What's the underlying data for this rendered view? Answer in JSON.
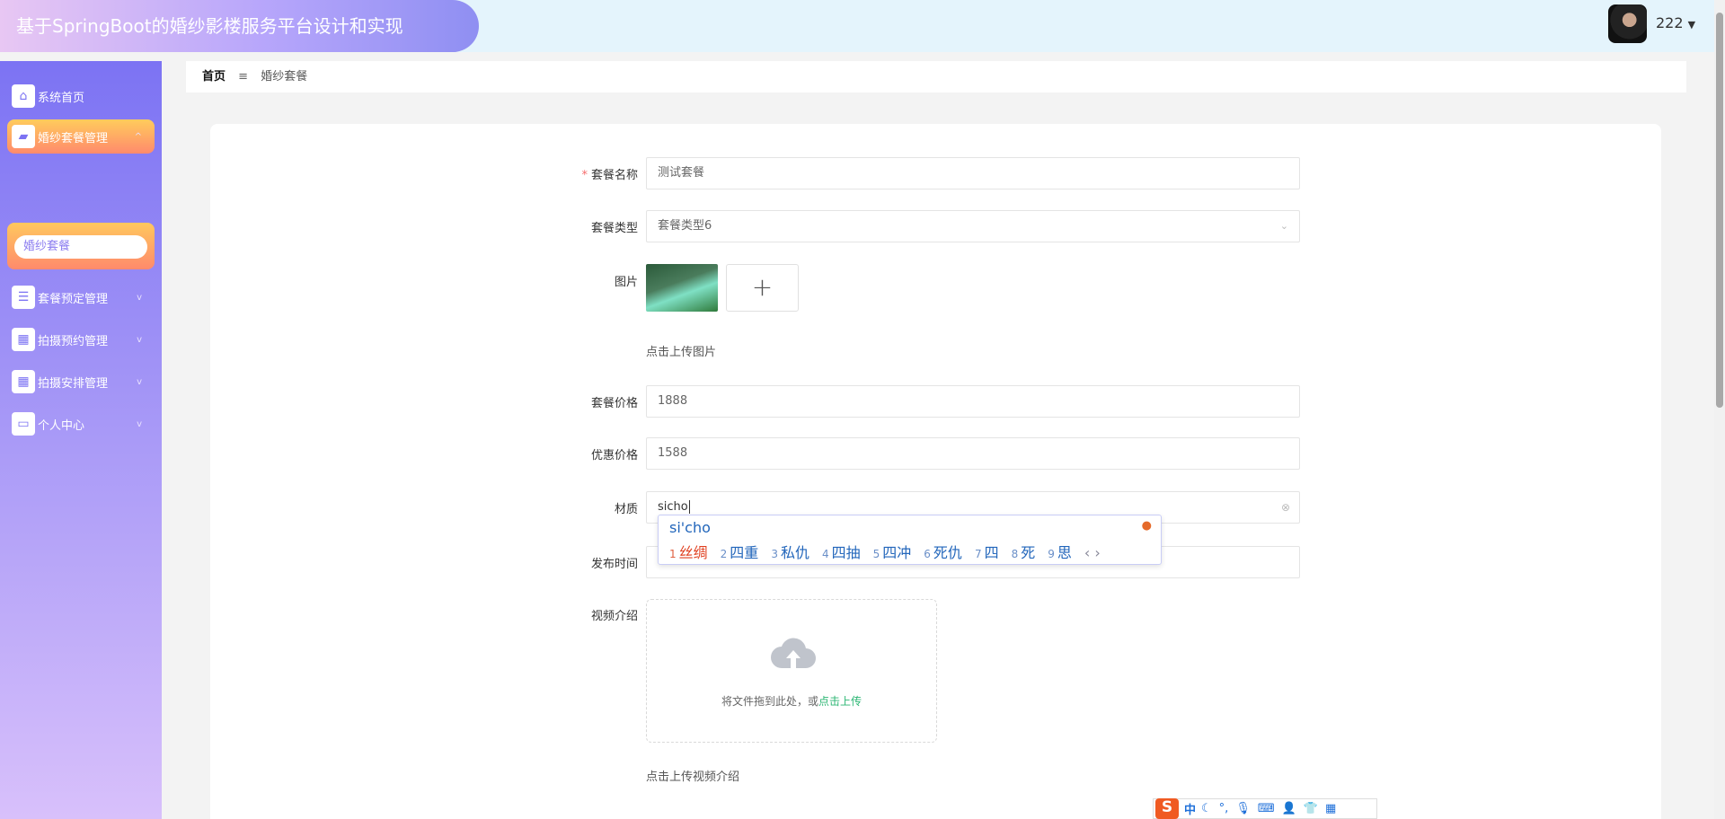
{
  "header": {
    "title": "基于SpringBoot的婚纱影楼服务平台设计和实现",
    "username": "222",
    "caret": "▼"
  },
  "sidebar": {
    "items": [
      {
        "label": "系统首页",
        "icon": "home-icon",
        "glyph": "⌂"
      },
      {
        "label": "婚纱套餐管理",
        "icon": "wallet-icon",
        "glyph": "▰",
        "chev": "^"
      },
      {
        "label": "套餐预定管理",
        "icon": "list-icon",
        "glyph": "☰",
        "chev": "v"
      },
      {
        "label": "拍摄预约管理",
        "icon": "grid-icon",
        "glyph": "▦",
        "chev": "v"
      },
      {
        "label": "拍摄安排管理",
        "icon": "grid-icon",
        "glyph": "▦",
        "chev": "v"
      },
      {
        "label": "个人中心",
        "icon": "card-icon",
        "glyph": "▭",
        "chev": "v"
      }
    ],
    "sub_item": "婚纱套餐"
  },
  "breadcrumb": {
    "home": "首页",
    "sep": "≡",
    "current": "婚纱套餐"
  },
  "form": {
    "name": {
      "label": "套餐名称",
      "value": "测试套餐",
      "required": "*"
    },
    "type": {
      "label": "套餐类型",
      "value": "套餐类型6"
    },
    "image": {
      "label": "图片",
      "hint": "点击上传图片",
      "add": "+"
    },
    "price": {
      "label": "套餐价格",
      "value": "1888"
    },
    "discount": {
      "label": "优惠价格",
      "value": "1588"
    },
    "material": {
      "label": "材质",
      "value": "sicho"
    },
    "publish": {
      "label": "发布时间"
    },
    "video": {
      "label": "视频介绍",
      "drop_text": "将文件拖到此处，或",
      "drop_link": "点击上传",
      "hint": "点击上传视频介绍"
    }
  },
  "ime": {
    "composition": "si'cho",
    "candidates": [
      {
        "n": "1",
        "t": "丝绸"
      },
      {
        "n": "2",
        "t": "四重"
      },
      {
        "n": "3",
        "t": "私仇"
      },
      {
        "n": "4",
        "t": "四抽"
      },
      {
        "n": "5",
        "t": "四冲"
      },
      {
        "n": "6",
        "t": "死仇"
      },
      {
        "n": "7",
        "t": "四"
      },
      {
        "n": "8",
        "t": "死"
      },
      {
        "n": "9",
        "t": "思"
      }
    ],
    "nav": "‹ ›"
  },
  "sogou_toolbar": {
    "logo": "S",
    "mode": "中",
    "items": [
      "☾",
      "°,",
      "🎙",
      "⌨",
      "👤",
      "👕",
      "▦"
    ]
  }
}
